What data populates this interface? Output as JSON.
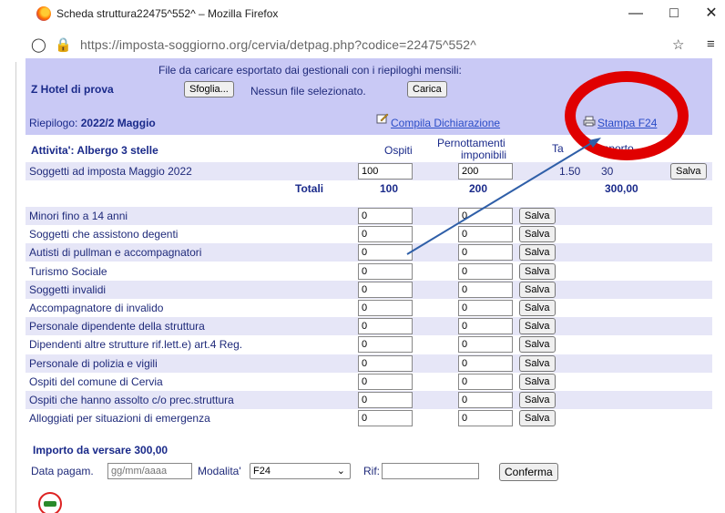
{
  "window": {
    "title": "Scheda struttura22475^552^ – Mozilla Firefox",
    "url": "https://imposta-soggiorno.org/cervia/detpag.php?codice=22475^552^"
  },
  "header": {
    "hotel_name": "Z Hotel di prova",
    "upload_note": "File da caricare esportato dai gestionali con i riepiloghi mensili:",
    "browse_label": "Sfoglia...",
    "no_file_label": "Nessun file selezionato.",
    "load_label": "Carica",
    "riepilogo_prefix": "Riepilogo:",
    "riepilogo_period": "2022/2 Maggio",
    "compila_label": "Compila Dichiarazione",
    "stampa_label": "Stampa F24"
  },
  "columns": {
    "activity": "Attivita': Albergo 3 stelle",
    "guests": "Ospiti",
    "nights_line1": "Pernottamenti",
    "nights_line2": "imponibili",
    "tax": "Ta",
    "amount": "Importo"
  },
  "taxable": {
    "label": "Soggetti ad imposta Maggio 2022",
    "guests": "100",
    "nights": "200",
    "rate": "1.50",
    "amount_partial": "30",
    "save_label": "Salva"
  },
  "totals": {
    "label": "Totali",
    "guests": "100",
    "nights": "200",
    "amount": "300,00"
  },
  "exemptions": [
    {
      "label": "Minori fino a 14 anni",
      "guests": "0",
      "nights": "0",
      "save": "Salva"
    },
    {
      "label": "Soggetti che assistono degenti",
      "guests": "0",
      "nights": "0",
      "save": "Salva"
    },
    {
      "label": "Autisti di pullman e accompagnatori",
      "guests": "0",
      "nights": "0",
      "save": "Salva"
    },
    {
      "label": "Turismo Sociale",
      "guests": "0",
      "nights": "0",
      "save": "Salva"
    },
    {
      "label": "Soggetti invalidi",
      "guests": "0",
      "nights": "0",
      "save": "Salva"
    },
    {
      "label": "Accompagnatore di invalido",
      "guests": "0",
      "nights": "0",
      "save": "Salva"
    },
    {
      "label": "Personale dipendente della struttura",
      "guests": "0",
      "nights": "0",
      "save": "Salva"
    },
    {
      "label": "Dipendenti altre strutture rif.lett.e) art.4 Reg.",
      "guests": "0",
      "nights": "0",
      "save": "Salva"
    },
    {
      "label": "Personale di polizia e vigili",
      "guests": "0",
      "nights": "0",
      "save": "Salva"
    },
    {
      "label": "Ospiti del comune di Cervia",
      "guests": "0",
      "nights": "0",
      "save": "Salva"
    },
    {
      "label": "Ospiti che hanno assolto c/o prec.struttura",
      "guests": "0",
      "nights": "0",
      "save": "Salva"
    },
    {
      "label": "Alloggiati per situazioni di emergenza",
      "guests": "0",
      "nights": "0",
      "save": "Salva"
    }
  ],
  "payment": {
    "amount_line": "Importo da versare 300,00",
    "date_label": "Data pagam.",
    "date_placeholder": "gg/mm/aaaa",
    "mode_label": "Modalita'",
    "mode_value": "F24",
    "ref_label": "Rif:",
    "confirm_label": "Conferma"
  },
  "colors": {
    "header_bg": "#c9c9f5",
    "alt_row_bg": "#e6e6f7",
    "text": "#1f2a7a",
    "link": "#2a4cc7",
    "annotation_red": "#e00000",
    "annotation_arrow": "#2f5fa8"
  }
}
